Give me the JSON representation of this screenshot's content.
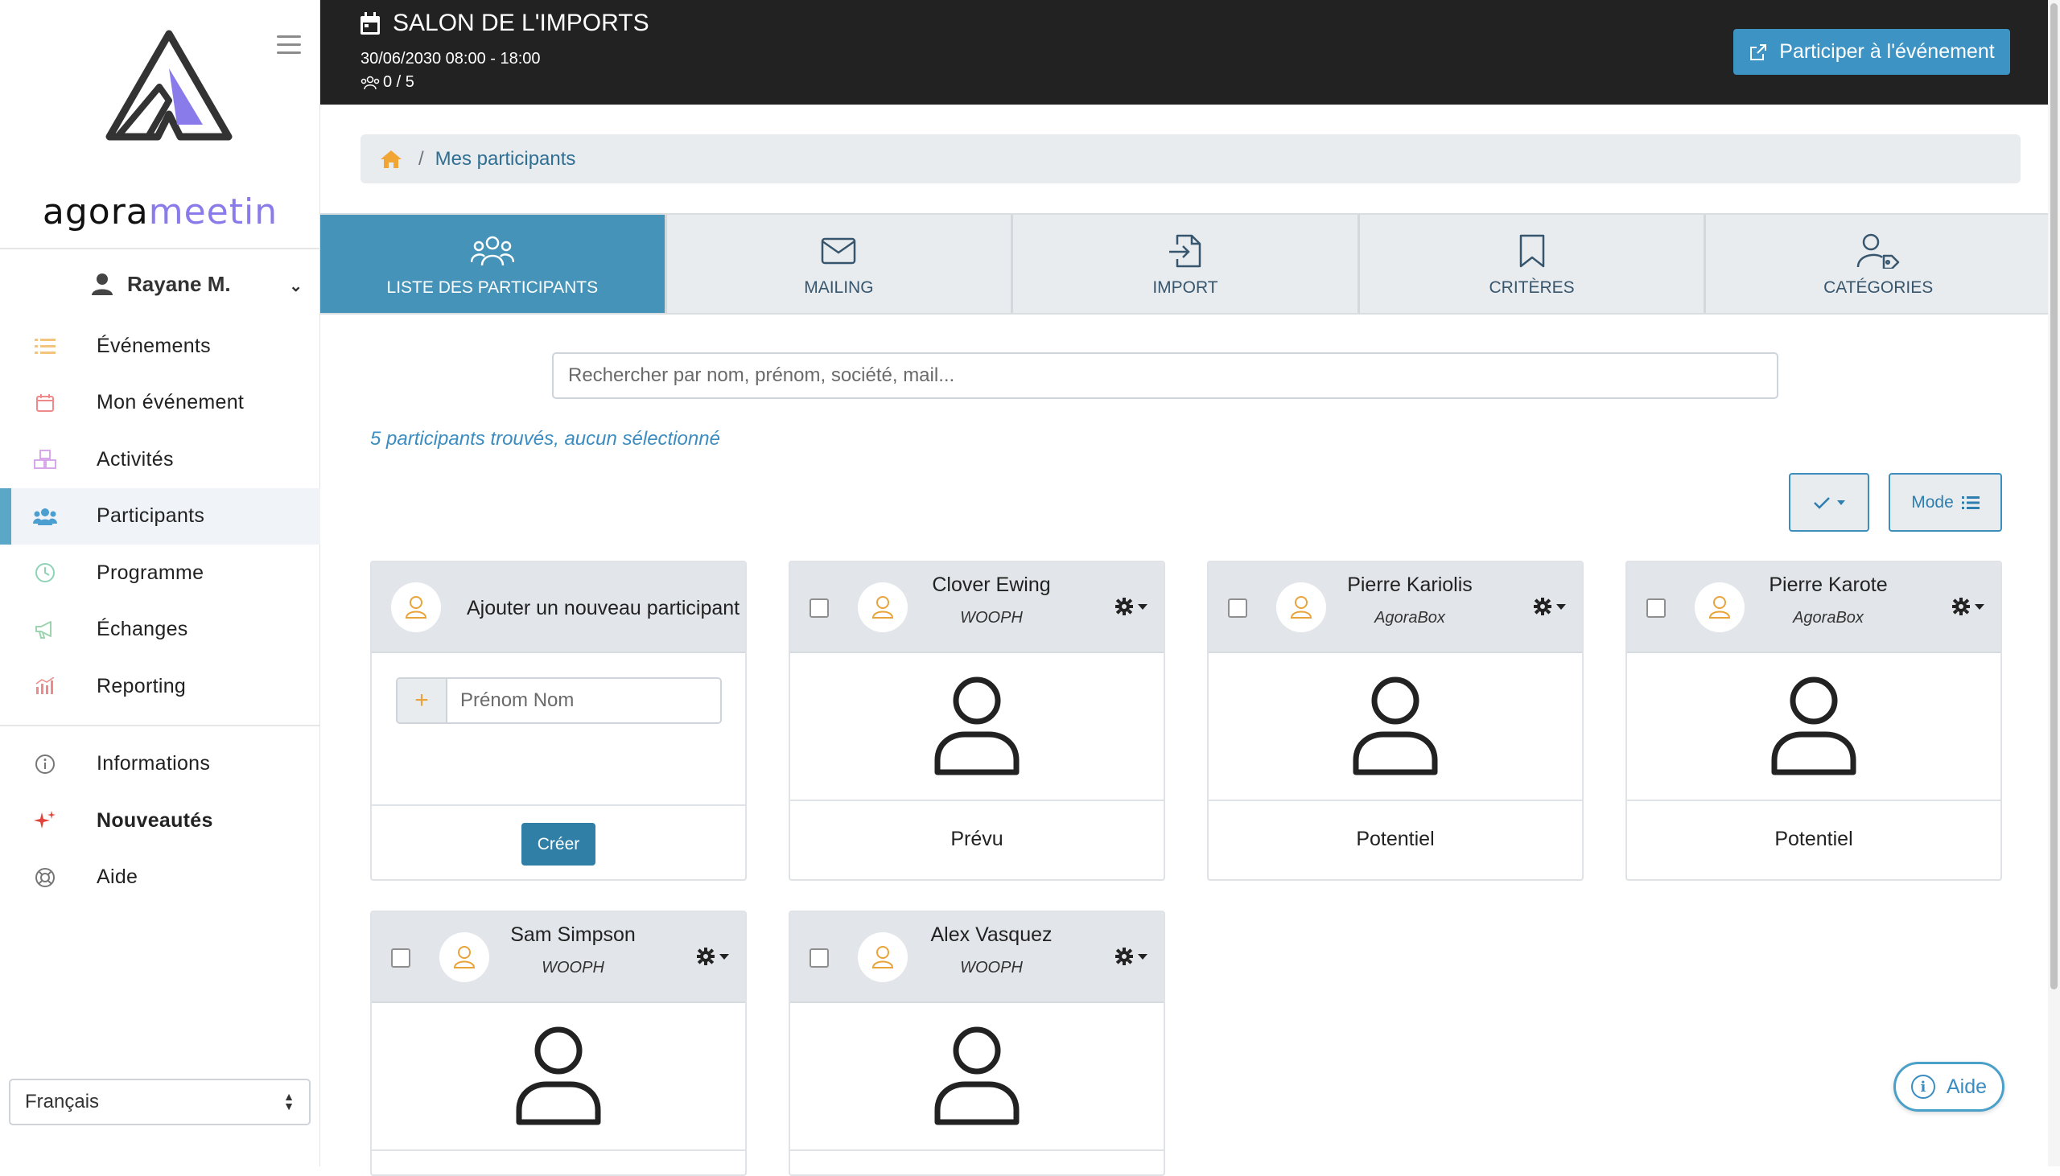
{
  "brand": {
    "part1": "agora",
    "part2": "meetin"
  },
  "user": {
    "name": "Rayane M."
  },
  "nav": {
    "items": [
      {
        "label": "Événements",
        "icon": "list-icon",
        "color": "#f3c47b"
      },
      {
        "label": "Mon événement",
        "icon": "calendar-icon",
        "color": "#f08a8a"
      },
      {
        "label": "Activités",
        "icon": "cubes-icon",
        "color": "#d9a8e8"
      },
      {
        "label": "Participants",
        "icon": "users-icon",
        "color": "#4a9fd0"
      },
      {
        "label": "Programme",
        "icon": "clock-icon",
        "color": "#8fd3b5"
      },
      {
        "label": "Échanges",
        "icon": "megaphone-icon",
        "color": "#9ed3b0"
      },
      {
        "label": "Reporting",
        "icon": "chart-icon",
        "color": "#f08a8a"
      }
    ],
    "secondary": [
      {
        "label": "Informations",
        "icon": "info-icon"
      },
      {
        "label": "Nouveautés",
        "icon": "sparkle-icon"
      },
      {
        "label": "Aide",
        "icon": "lifebuoy-icon"
      }
    ],
    "active_index": 3
  },
  "language": {
    "selected": "Français"
  },
  "event": {
    "title": "SALON DE L'IMPORTS",
    "datetime": "30/06/2030 08:00 - 18:00",
    "participants_count": "0 / 5",
    "join_label": "Participer à l'événement"
  },
  "breadcrumb": {
    "current": "Mes participants",
    "separator": "/"
  },
  "tabs": [
    {
      "label": "LISTE DES PARTICIPANTS",
      "icon": "users-icon",
      "active": true
    },
    {
      "label": "MAILING",
      "icon": "envelope-icon",
      "active": false
    },
    {
      "label": "IMPORT",
      "icon": "file-import-icon",
      "active": false
    },
    {
      "label": "CRITÈRES",
      "icon": "bookmark-icon",
      "active": false
    },
    {
      "label": "CATÉGORIES",
      "icon": "user-tag-icon",
      "active": false
    }
  ],
  "search": {
    "placeholder": "Rechercher par nom, prénom, société, mail..."
  },
  "results_text": "5 participants trouvés, aucun sélectionné",
  "toolbar": {
    "mode_label": "Mode"
  },
  "add_card": {
    "title": "Ajouter un nouveau participant",
    "input_placeholder": "Prénom Nom",
    "create_label": "Créer"
  },
  "participants": [
    {
      "name": "Clover Ewing",
      "company": "WOOPH",
      "status": "Prévu"
    },
    {
      "name": "Pierre Kariolis",
      "company": "AgoraBox",
      "status": "Potentiel"
    },
    {
      "name": "Pierre Karote",
      "company": "AgoraBox",
      "status": "Potentiel"
    },
    {
      "name": "Sam Simpson",
      "company": "WOOPH",
      "status": ""
    },
    {
      "name": "Alex Vasquez",
      "company": "WOOPH",
      "status": ""
    }
  ],
  "help": {
    "label": "Aide"
  },
  "colors": {
    "accent": "#4593b9",
    "topbar": "#222222",
    "brand_purple": "#8a7bea",
    "avatar_orange": "#e8a33a"
  }
}
